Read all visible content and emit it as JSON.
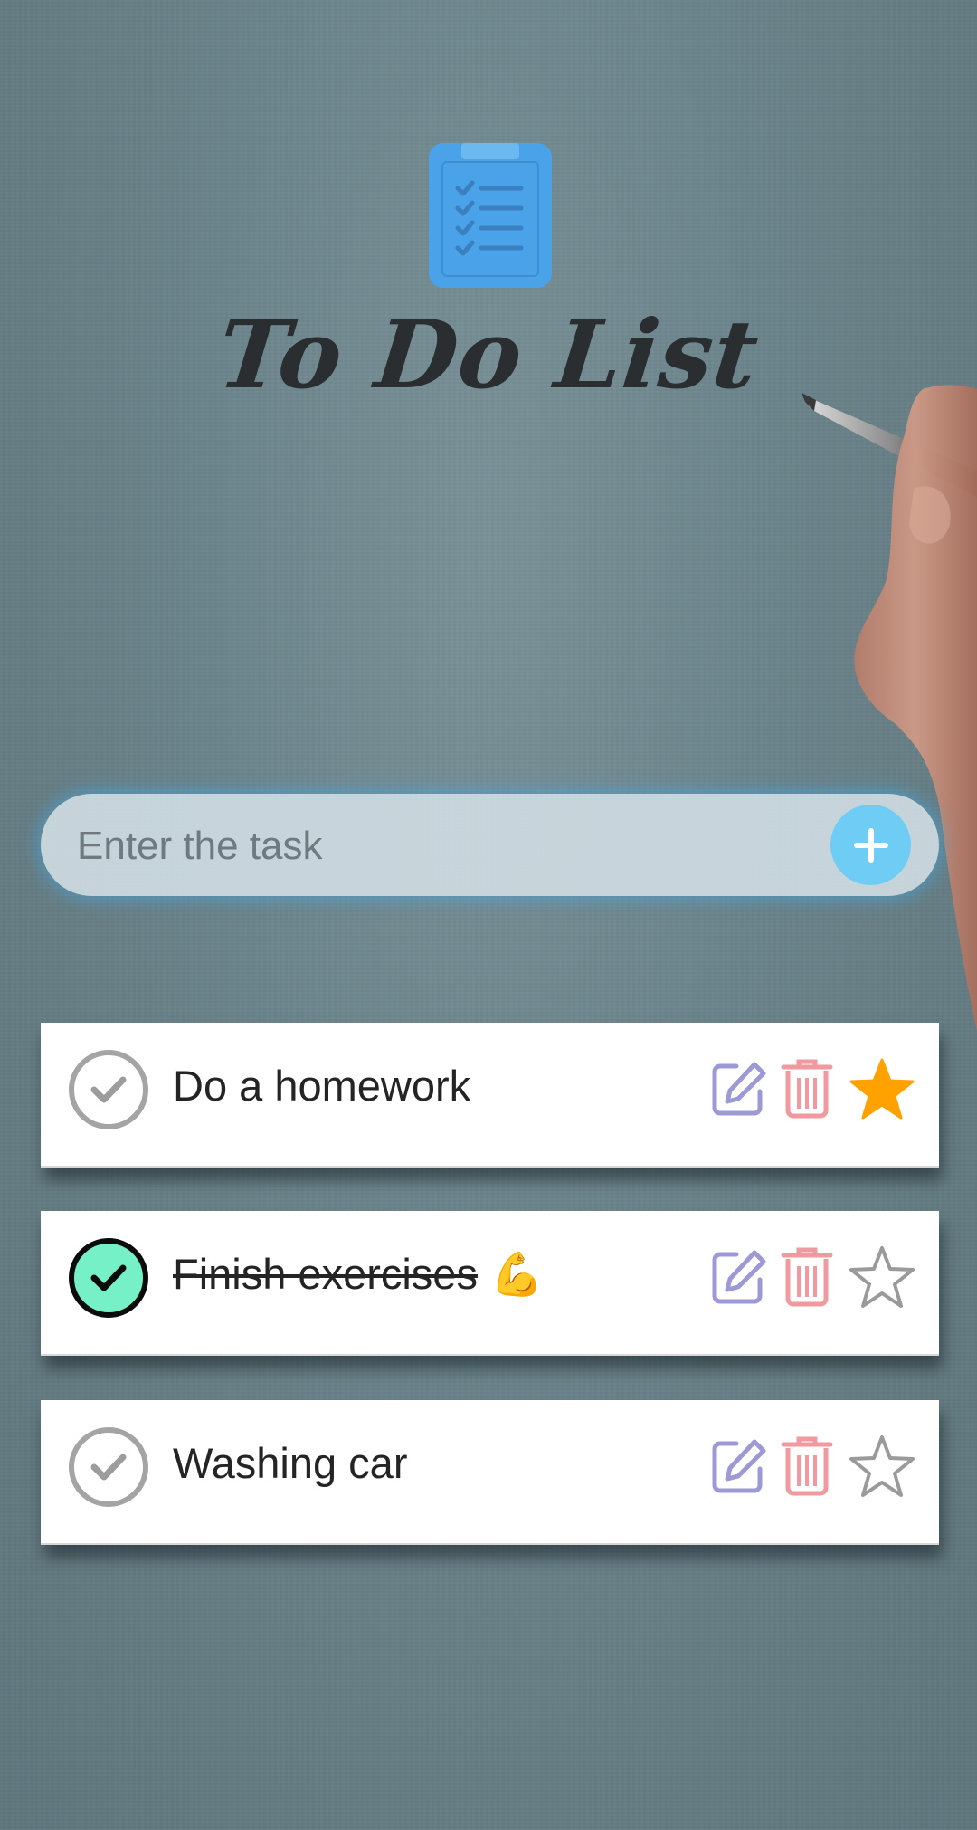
{
  "app": {
    "title": "To Do List"
  },
  "input": {
    "placeholder": "Enter the task",
    "value": "",
    "add_button_icon": "plus-icon"
  },
  "tasks": [
    {
      "text": "Do a homework",
      "emoji": "",
      "completed": false,
      "starred": true
    },
    {
      "text": "Finish exercises",
      "emoji": "💪",
      "completed": true,
      "starred": false
    },
    {
      "text": "Washing car",
      "emoji": "",
      "completed": false,
      "starred": false
    }
  ],
  "icons": {
    "logo": "clipboard-checklist-icon",
    "check": "check-icon",
    "edit": "edit-icon",
    "delete": "trash-icon",
    "star": "star-icon"
  },
  "colors": {
    "accent": "#4aa3e8",
    "add_button": "#6fcdf5",
    "edit_icon": "#9c9ad6",
    "delete_icon": "#f09a9f",
    "star_active": "#ffa200",
    "star_inactive": "#9a9a9a",
    "check_done_fill": "#76f0c7"
  }
}
